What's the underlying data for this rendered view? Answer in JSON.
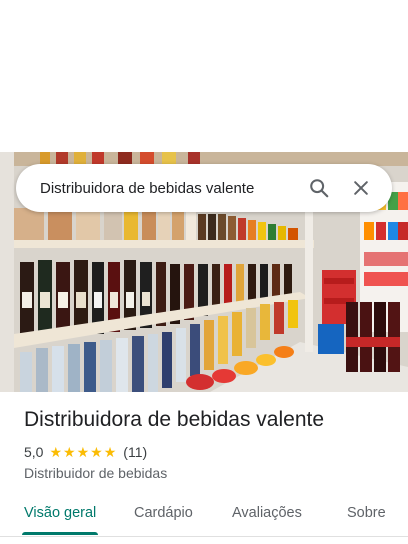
{
  "search": {
    "query": "Distribuidora de bebidas valente",
    "search_icon": "search-icon",
    "close_icon": "close-icon"
  },
  "photo": {
    "description_icon": "store-photo"
  },
  "place": {
    "name": "Distribuidora de bebidas valente",
    "rating": "5,0",
    "stars": 5,
    "review_count": "(11)",
    "category": "Distribuidor de bebidas"
  },
  "tabs": [
    {
      "label": "Visão geral",
      "active": true
    },
    {
      "label": "Cardápio",
      "active": false
    },
    {
      "label": "Avaliações",
      "active": false
    },
    {
      "label": "Sobre",
      "active": false
    }
  ],
  "colors": {
    "accent": "#00796b",
    "star": "#fbbc04",
    "text_primary": "#202124",
    "text_secondary": "#5f6368"
  }
}
